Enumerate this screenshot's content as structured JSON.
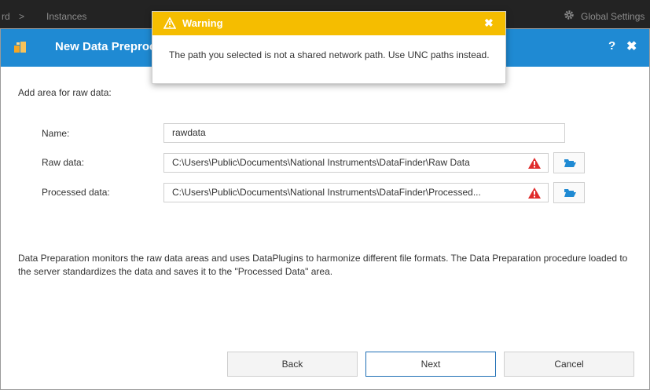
{
  "topbar": {
    "crumb_partial": "rd",
    "separator": ">",
    "instances": "Instances",
    "global_settings": "Global Settings"
  },
  "dialog": {
    "title": "New Data Preproc",
    "help": "?",
    "close": "✖",
    "section_label": "Add area for raw data:",
    "fields": [
      {
        "label": "Name:",
        "value": "rawdata"
      },
      {
        "label": "Raw data:",
        "value": "C:\\Users\\Public\\Documents\\National Instruments\\DataFinder\\Raw Data"
      },
      {
        "label": "Processed data:",
        "value": "C:\\Users\\Public\\Documents\\National Instruments\\DataFinder\\Processed..."
      }
    ],
    "description": "Data Preparation monitors the raw data areas and uses DataPlugins to harmonize different file formats. The Data Preparation procedure loaded to the server standardizes the data and saves it to the \"Processed Data\" area.",
    "buttons": {
      "back": "Back",
      "next": "Next",
      "cancel": "Cancel"
    }
  },
  "toast": {
    "title": "Warning",
    "close": "✖",
    "message": "The path you selected is not a shared network path. Use UNC paths instead."
  },
  "colors": {
    "header_blue": "#1f8ad3",
    "warning_yellow": "#f5bd00",
    "error_red": "#e02b2b",
    "folder_blue": "#1f8ad3"
  },
  "icons": [
    "gear-icon",
    "app-logo-icon",
    "warning-icon",
    "error-triangle-icon",
    "folder-open-icon"
  ]
}
